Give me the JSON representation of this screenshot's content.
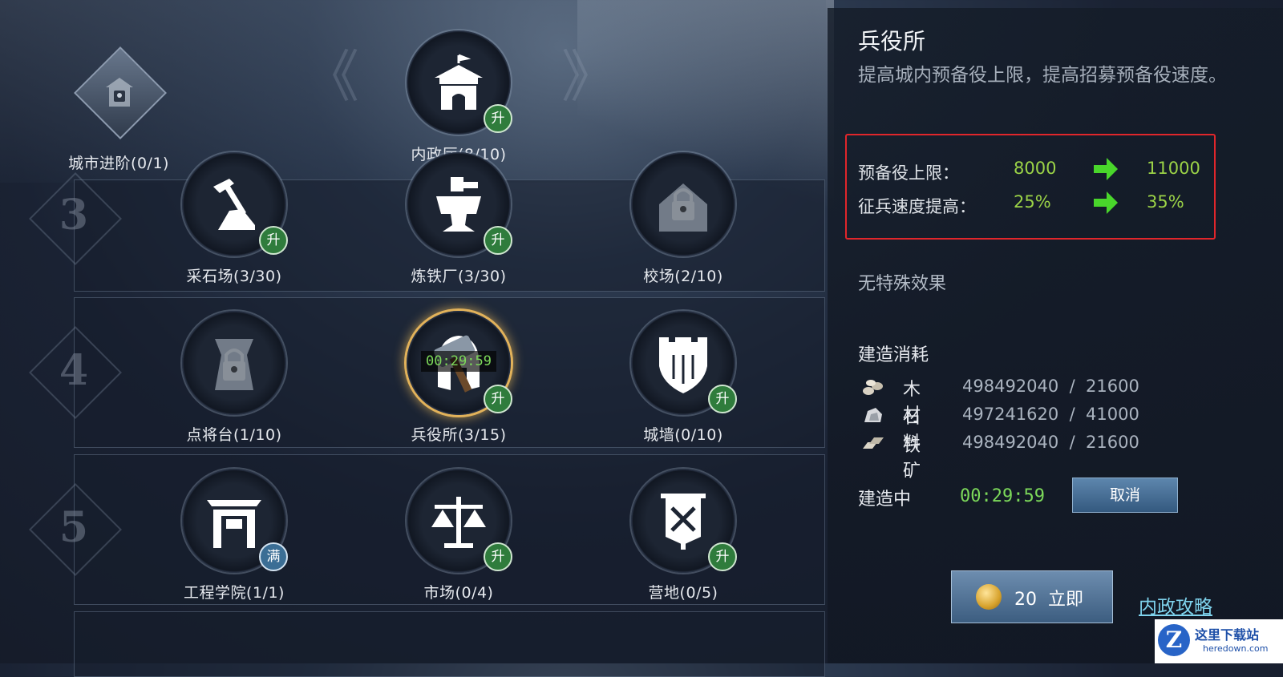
{
  "city_upgrade": {
    "label": "城市进阶(0/1)"
  },
  "top_building": {
    "label": "内政厅(8/10)",
    "badge": "升"
  },
  "tiers": [
    "3",
    "4",
    "5"
  ],
  "row3": [
    {
      "label": "采石场(3/30)",
      "badge": "升",
      "icon": "pickaxe-icon"
    },
    {
      "label": "炼铁厂(3/30)",
      "badge": "升",
      "icon": "furnace-icon"
    },
    {
      "label": "校场(2/10)",
      "badge": "",
      "icon": "lock-icon"
    }
  ],
  "row4": [
    {
      "label": "点将台(1/10)",
      "badge": "",
      "icon": "lock-icon"
    },
    {
      "label": "兵役所(3/15)",
      "badge": "升",
      "icon": "helmet-icon",
      "timer": "00:29:59"
    },
    {
      "label": "城墙(0/10)",
      "badge": "升",
      "icon": "wall-shield-icon"
    }
  ],
  "row5": [
    {
      "label": "工程学院(1/1)",
      "badge": "满",
      "icon": "gate-icon"
    },
    {
      "label": "市场(0/4)",
      "badge": "升",
      "icon": "scales-icon"
    },
    {
      "label": "营地(0/5)",
      "badge": "升",
      "icon": "banner-icon"
    }
  ],
  "panel": {
    "title": "兵役所",
    "description": "提高城内预备役上限，提高招募预备役速度。",
    "stats": [
      {
        "name": "预备役上限：",
        "from": "8000",
        "to": "11000"
      },
      {
        "name": "征兵速度提高：",
        "from": "25%",
        "to": "35%"
      }
    ],
    "special_effect": "无特殊效果",
    "cost_title": "建造消耗",
    "costs": [
      {
        "name": "木材",
        "have": "498492040",
        "sep": "/",
        "need": "21600",
        "icon": "wood-icon"
      },
      {
        "name": "石料",
        "have": "497241620",
        "sep": "/",
        "need": "41000",
        "icon": "stone-icon"
      },
      {
        "name": "铁矿",
        "have": "498492040",
        "sep": "/",
        "need": "21600",
        "icon": "iron-icon"
      }
    ],
    "building_label": "建造中",
    "building_timer": "00:29:59",
    "cancel_label": "取消",
    "instant_cost": "20",
    "instant_label": "立即",
    "guide_link": "内政攻略"
  },
  "watermark": {
    "cn": "这里下载站",
    "en": "heredown.com",
    "logo": "Z"
  },
  "colors": {
    "accent_green": "#7cd95a",
    "stat_green": "#9bd347",
    "highlight_red": "#e0262b",
    "upgrade_badge": "#2f7c3c",
    "full_badge": "#3b6e95"
  }
}
